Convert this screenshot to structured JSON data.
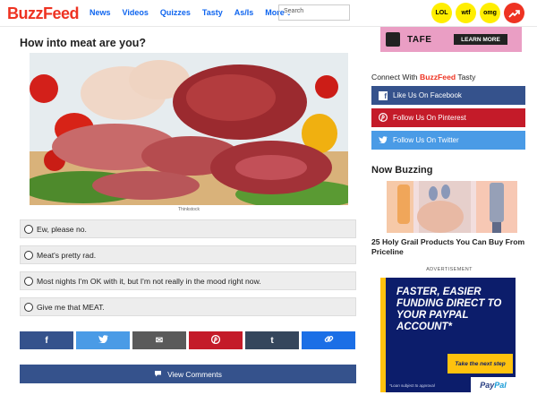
{
  "header": {
    "logo": "BuzzFeed",
    "nav": [
      "News",
      "Videos",
      "Quizzes",
      "Tasty",
      "As/Is",
      "More"
    ],
    "search_placeholder": "Search",
    "badges": [
      "LOL",
      "wtf",
      "omg"
    ]
  },
  "quiz": {
    "question": "How into meat are you?",
    "image_caption": "Thinkstock",
    "answers": [
      "Ew, please no.",
      "Meat's pretty rad.",
      "Most nights I'm OK with it, but I'm not really in the mood right now.",
      "Give me that MEAT."
    ]
  },
  "share": {
    "buttons": [
      {
        "name": "facebook",
        "color": "#35528c",
        "glyph": "f"
      },
      {
        "name": "twitter",
        "color": "#4a9be6",
        "glyph": "🐦"
      },
      {
        "name": "email",
        "color": "#5a5a5a",
        "glyph": "✉"
      },
      {
        "name": "pinterest",
        "color": "#c41b29",
        "glyph": "P"
      },
      {
        "name": "tumblr",
        "color": "#35465c",
        "glyph": "t"
      },
      {
        "name": "link",
        "color": "#1b6fe6",
        "glyph": "🔗"
      }
    ],
    "view_comments": "View Comments"
  },
  "sidebar": {
    "top_ad": {
      "brand": "TAFE",
      "cta": "LEARN MORE"
    },
    "connect_prefix": "Connect With",
    "connect_brand": "BuzzFeed",
    "connect_suffix": "Tasty",
    "social": [
      {
        "label": "Like Us On Facebook",
        "color": "#35528c",
        "icon": "f"
      },
      {
        "label": "Follow Us On Pinterest",
        "color": "#c41b29",
        "icon": "P"
      },
      {
        "label": "Follow Us On Twitter",
        "color": "#4a9be6",
        "icon": "t"
      }
    ],
    "now_buzzing": "Now Buzzing",
    "buzz_headline": "25 Holy Grail Products You Can Buy From Priceline",
    "advertisement_label": "ADVERTISEMENT",
    "paypal_ad": {
      "headline": "FASTER, EASIER FUNDING DIRECT TO YOUR PAYPAL ACCOUNT*",
      "cta": "Take the next step",
      "fine_print": "*Loan subject to approval",
      "brand_part1": "Pay",
      "brand_part2": "Pal"
    }
  }
}
